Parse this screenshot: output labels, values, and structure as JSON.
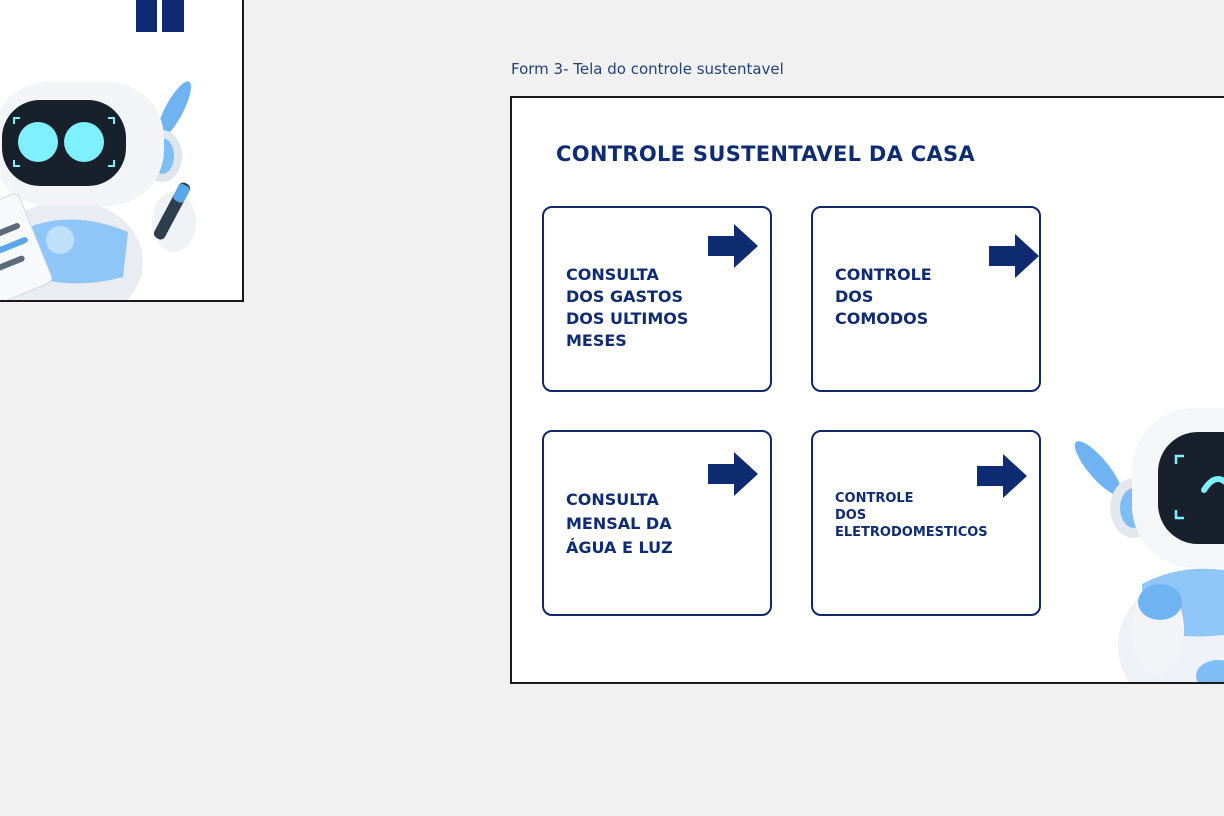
{
  "caption": "Form 3- Tela do controle sustentavel",
  "form": {
    "title": "CONTROLE SUSTENTAVEL DA CASA",
    "cards": [
      {
        "label": "CONSULTA\nDOS GASTOS\nDOS ULTIMOS\nMESES",
        "icon": "arrow-right-icon"
      },
      {
        "label": "CONTROLE\nDOS\nCOMODOS",
        "icon": "arrow-right-icon"
      },
      {
        "label": "CONSULTA\nMENSAL DA\nÁGUA E LUZ",
        "icon": "arrow-right-icon"
      },
      {
        "label": "CONTROLE\nDOS\nELETRODOMESTICOS",
        "icon": "arrow-right-icon"
      }
    ]
  },
  "images": {
    "left": "robot-writing-illustration",
    "right": "robot-mascot-illustration"
  },
  "colors": {
    "brand_navy": "#0f2b72",
    "card_border": "#10286b",
    "caption": "#23437a",
    "robot_blue": "#6fb3f2",
    "robot_eye": "#7ff0ff",
    "page_background": "#f1f1f1"
  }
}
